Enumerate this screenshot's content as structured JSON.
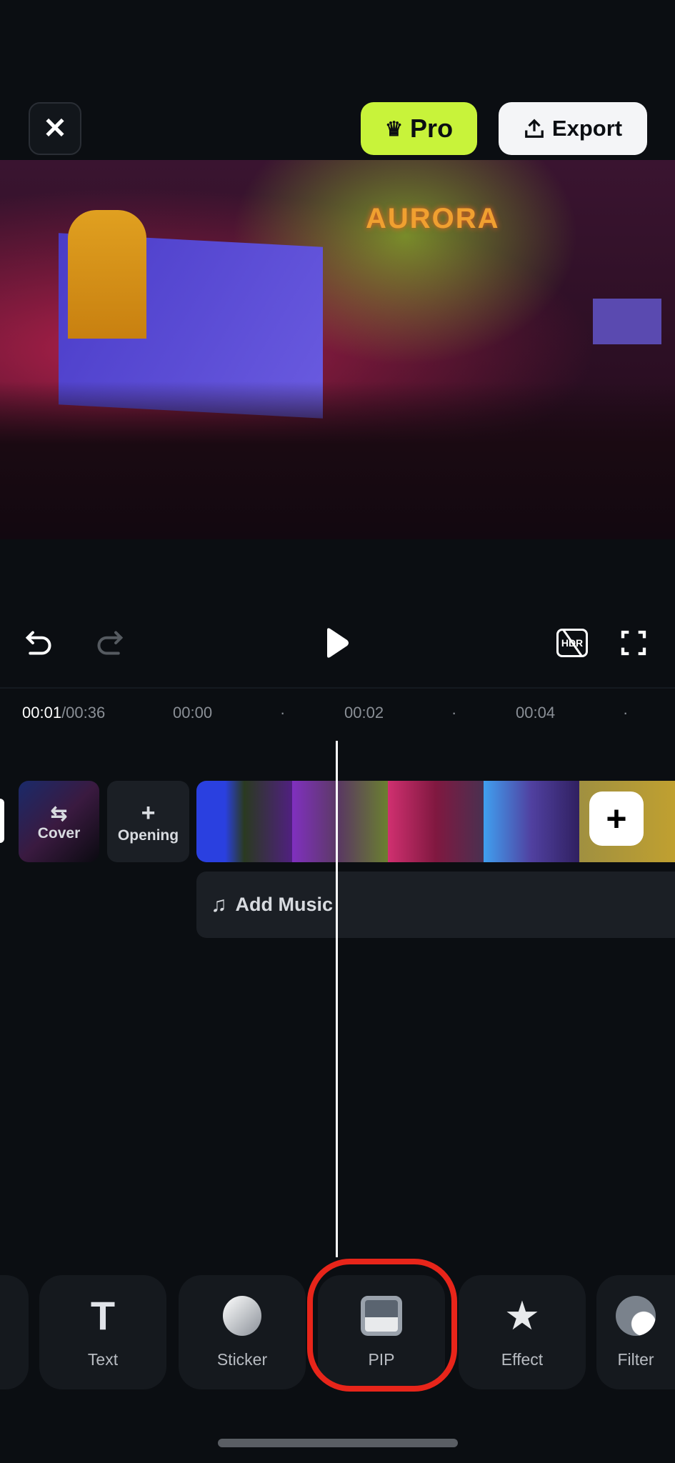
{
  "header": {
    "close_icon": "close-icon",
    "pro_label": "Pro",
    "export_label": "Export"
  },
  "preview": {
    "stage_text": "AURORA"
  },
  "controls": {
    "undo": "undo-icon",
    "redo": "redo-icon",
    "play": "play-icon",
    "hdr": "HDR",
    "fullscreen": "fullscreen-icon"
  },
  "timeline": {
    "current": "00:01",
    "total": "/00:36",
    "ticks": [
      "00:00",
      "00:02",
      "00:04"
    ],
    "cover_label": "Cover",
    "opening_label": "Opening",
    "add_music_label": "Add Music"
  },
  "toolbar": {
    "items": [
      {
        "label": "Text"
      },
      {
        "label": "Sticker"
      },
      {
        "label": "PIP"
      },
      {
        "label": "Effect"
      },
      {
        "label": "Filter"
      }
    ]
  },
  "colors": {
    "pro": "#c8f33a",
    "highlight": "#e8251a"
  }
}
